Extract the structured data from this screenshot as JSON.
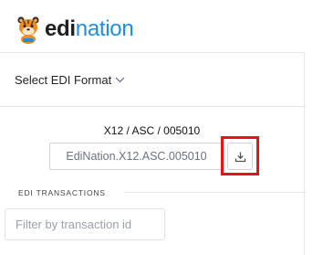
{
  "header": {
    "brand_primary": "edi",
    "brand_secondary": "nation",
    "logo_icon": "tiger-mascot-icon"
  },
  "format_select": {
    "label": "Select EDI Format",
    "icon": "chevron-down-icon"
  },
  "format": {
    "current_label": "X12 / ASC / 005010",
    "field_value": "EdiNation.X12.ASC.005010",
    "download_icon": "download-icon"
  },
  "transactions": {
    "section_label": "EDI TRANSACTIONS",
    "filter_placeholder": "Filter by transaction id",
    "filter_value": ""
  },
  "colors": {
    "brand_blue": "#1e8fe0",
    "highlight_red": "#e2141d",
    "mascot_orange": "#f08c1a"
  }
}
